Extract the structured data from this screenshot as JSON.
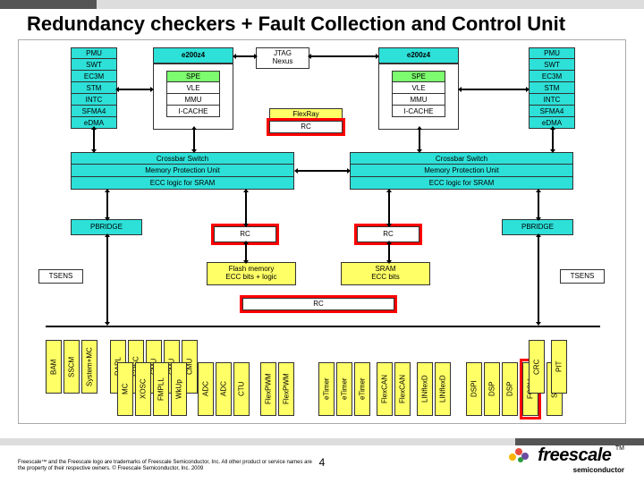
{
  "title": "Redundancy checkers + Fault Collection and Control Unit",
  "left_pmu": [
    "PMU",
    "SWT",
    "EC3M",
    "STM",
    "INTC",
    "SFMA4",
    "eDMA"
  ],
  "right_pmu": [
    "PMU",
    "SWT",
    "EC3M",
    "STM",
    "INTC",
    "SFMA4",
    "eDMA"
  ],
  "core_top": "e200z4",
  "jtag": "JTAG\nNexus",
  "core_left": [
    "SPE",
    "VLE",
    "MMU",
    "I-CACHE"
  ],
  "core_right": [
    "SPE",
    "VLE",
    "MMU",
    "I-CACHE"
  ],
  "flexray": "FlexRay",
  "rc_fx": "RC",
  "xbar_left": [
    "Crossbar Switch",
    "Memory Protection Unit",
    "ECC logic for SRAM"
  ],
  "xbar_right": [
    "Crossbar Switch",
    "Memory Protection Unit",
    "ECC logic for SRAM"
  ],
  "pbridge": "PBRIDGE",
  "rc_l": "RC",
  "rc_r": "RC",
  "flash": "Flash memory\nECC bits + logic",
  "sram": "SRAM\nECC bits",
  "tsens": "TSENS",
  "rc_mid": "RC",
  "bottom_a": [
    "BAM",
    "SSCM",
    "System+MC"
  ],
  "bottom_b": [
    "RAPL",
    "SOSC",
    "CMU",
    "CMU",
    "CMU"
  ],
  "bottom_c": [
    "MC",
    "XOSC",
    "FMPLL",
    "WkUp",
    "ADC",
    "ADC",
    "CTU",
    "FlexPWM",
    "FlexPWM"
  ],
  "bottom_d": [
    "eTimer",
    "eTimer",
    "eTimer",
    "FlexCAN",
    "FlexCAN",
    "LINflexD",
    "LINflexD"
  ],
  "bottom_e": [
    "DSPI",
    "DSP",
    "DSP",
    "FCCU",
    "SWG"
  ],
  "bottom_f": [
    "CRC",
    "PIT"
  ],
  "footer": "Freescale™ and the Freescale logo are trademarks of Freescale Semiconductor, Inc. All other product or service names are the property of their respective owners. © Freescale Semiconductor, Inc. 2009",
  "page": "4",
  "logo": "freescale",
  "logo_sub": "semiconductor",
  "tm": "TM"
}
